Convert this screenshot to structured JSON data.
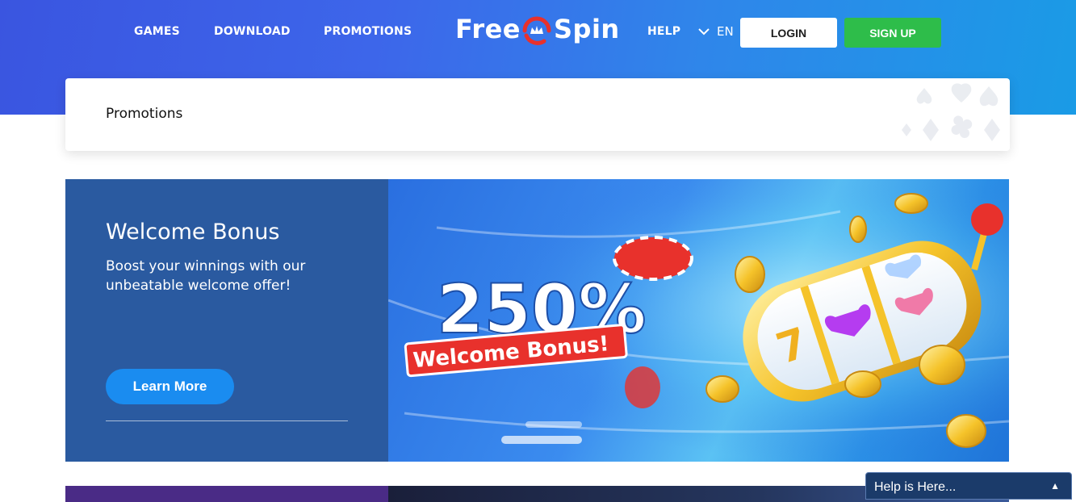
{
  "nav": {
    "games": "GAMES",
    "download": "DOWNLOAD",
    "promotions": "PROMOTIONS",
    "help": "HELP",
    "lang": "EN",
    "login": "LOGIN",
    "signup": "SIGN UP"
  },
  "logo": {
    "left": "Free",
    "right": "Spin"
  },
  "page": {
    "title": "Promotions"
  },
  "promo": {
    "title": "Welcome Bonus",
    "description": "Boost your winnings with our unbeatable welcome offer!",
    "cta": "Learn More",
    "banner_percent": "250%",
    "banner_ribbon": "Welcome Bonus!"
  },
  "help_widget": {
    "label": "Help is Here..."
  },
  "colors": {
    "accent_blue": "#1a8cf0",
    "signup_green": "#2ebd4a",
    "promo_panel": "#2a5aa0",
    "ribbon_red": "#e8312c"
  }
}
